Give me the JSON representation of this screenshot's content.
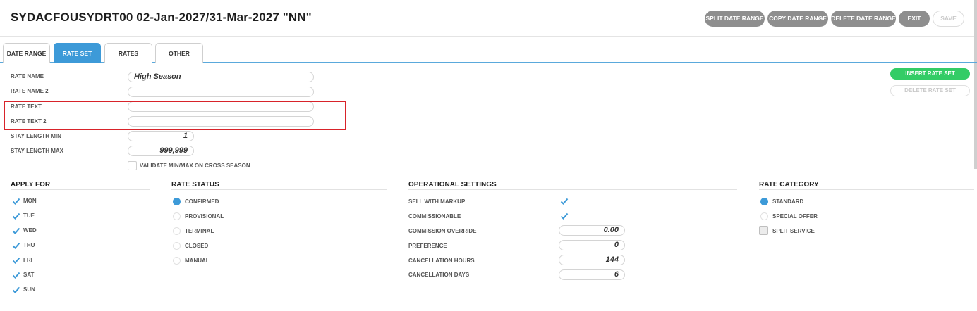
{
  "header": {
    "title": "SYDACFOUSYDRT00 02-Jan-2027/31-Mar-2027 \"NN\"",
    "buttons": {
      "split": "SPLIT DATE RANGE",
      "copy": "COPY DATE RANGE",
      "delete": "DELETE DATE RANGE",
      "exit": "EXIT",
      "save": "SAVE"
    }
  },
  "tabs": {
    "date_range": "DATE RANGE",
    "rate_set": "RATE SET",
    "rates": "RATES",
    "other": "OTHER",
    "active": "RATE SET"
  },
  "form": {
    "rate_name_label": "RATE NAME",
    "rate_name_value": "High Season",
    "rate_name2_label": "RATE NAME 2",
    "rate_name2_value": "",
    "rate_text_label": "RATE TEXT",
    "rate_text_value": "",
    "rate_text2_label": "RATE TEXT 2",
    "rate_text2_value": "",
    "stay_min_label": "STAY LENGTH MIN",
    "stay_min_value": "1",
    "stay_max_label": "STAY LENGTH MAX",
    "stay_max_value": "999,999",
    "validate_label": "VALIDATE MIN/MAX ON CROSS SEASON",
    "validate_checked": false
  },
  "side_buttons": {
    "insert": "INSERT RATE SET",
    "delete": "DELETE RATE SET"
  },
  "apply_for": {
    "title": "APPLY FOR",
    "days": [
      {
        "label": "MON",
        "checked": true
      },
      {
        "label": "TUE",
        "checked": true
      },
      {
        "label": "WED",
        "checked": true
      },
      {
        "label": "THU",
        "checked": true
      },
      {
        "label": "FRI",
        "checked": true
      },
      {
        "label": "SAT",
        "checked": true
      },
      {
        "label": "SUN",
        "checked": true
      }
    ]
  },
  "rate_status": {
    "title": "RATE STATUS",
    "options": [
      "CONFIRMED",
      "PROVISIONAL",
      "TERMINAL",
      "CLOSED",
      "MANUAL"
    ],
    "selected": "CONFIRMED"
  },
  "operational": {
    "title": "OPERATIONAL SETTINGS",
    "sell_with_markup_label": "SELL WITH MARKUP",
    "sell_with_markup": true,
    "commissionable_label": "COMMISSIONABLE",
    "commissionable": true,
    "commission_override_label": "COMMISSION OVERRIDE",
    "commission_override": "0.00",
    "preference_label": "PREFERENCE",
    "preference": "0",
    "cancellation_hours_label": "CANCELLATION HOURS",
    "cancellation_hours": "144",
    "cancellation_days_label": "CANCELLATION DAYS",
    "cancellation_days": "6"
  },
  "rate_category": {
    "title": "RATE CATEGORY",
    "options": [
      "STANDARD",
      "SPECIAL OFFER"
    ],
    "selected": "STANDARD",
    "split_service_label": "SPLIT SERVICE",
    "split_service_checked": false
  },
  "colors": {
    "accent": "#3d9ad8",
    "insert_green": "#33cc66",
    "grey_button": "#8e8e8e",
    "highlight_red": "#d8232a"
  }
}
